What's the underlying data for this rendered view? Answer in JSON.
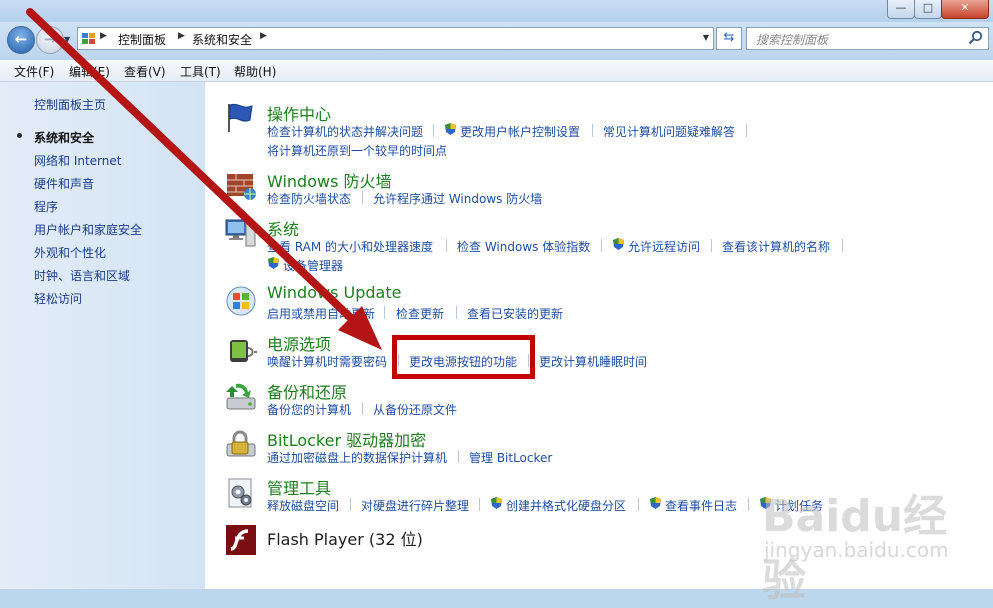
{
  "addressbar": {
    "breadcrumb": [
      "控制面板",
      "系统和安全"
    ],
    "search_placeholder": "搜索控制面板"
  },
  "window_controls": {
    "minimize": "—",
    "maximize": "□",
    "close": "✕"
  },
  "menu": [
    "文件(F)",
    "编辑(E)",
    "查看(V)",
    "工具(T)",
    "帮助(H)"
  ],
  "sidebar": {
    "home": "控制面板主页",
    "items": [
      "系统和安全",
      "网络和 Internet",
      "硬件和声音",
      "程序",
      "用户帐户和家庭安全",
      "外观和个性化",
      "时钟、语言和区域",
      "轻松访问"
    ],
    "current": "系统和安全"
  },
  "categories": [
    {
      "title": "操作中心",
      "icon": "action-center-flag-icon",
      "links": [
        "检查计算机的状态并解决问题",
        "更改用户帐户控制设置",
        "常见计算机问题疑难解答",
        "将计算机还原到一个较早的时间点"
      ]
    },
    {
      "title": "Windows 防火墙",
      "icon": "firewall-icon",
      "links": [
        "检查防火墙状态",
        "允许程序通过 Windows 防火墙"
      ]
    },
    {
      "title": "系统",
      "icon": "system-computer-icon",
      "links": [
        "查看 RAM 的大小和处理器速度",
        "检查 Windows 体验指数",
        "允许远程访问",
        "查看该计算机的名称",
        "设备管理器"
      ]
    },
    {
      "title": "Windows Update",
      "icon": "windows-update-icon",
      "links": [
        "启用或禁用自动更新",
        "检查更新",
        "查看已安装的更新"
      ]
    },
    {
      "title": "电源选项",
      "icon": "power-options-icon",
      "links": [
        "唤醒计算机时需要密码",
        "更改电源按钮的功能",
        "更改计算机睡眠时间"
      ]
    },
    {
      "title": "备份和还原",
      "icon": "backup-restore-icon",
      "links": [
        "备份您的计算机",
        "从备份还原文件"
      ]
    },
    {
      "title": "BitLocker 驱动器加密",
      "icon": "bitlocker-icon",
      "links": [
        "通过加密磁盘上的数据保护计算机",
        "管理 BitLocker"
      ]
    },
    {
      "title": "管理工具",
      "icon": "admin-tools-icon",
      "links": [
        "释放磁盘空间",
        "对硬盘进行碎片整理",
        "创建并格式化硬盘分区",
        "查看事件日志",
        "计划任务"
      ]
    },
    {
      "title": "Flash Player (32 位)",
      "icon": "flash-player-icon",
      "links": []
    }
  ],
  "watermark": {
    "logo": "Baidu经验",
    "url": "jingyan.baidu.com"
  },
  "colors": {
    "title_green": "#1e7f1e",
    "link_blue": "#1f4ea3",
    "annotation_red": "#c40000"
  }
}
